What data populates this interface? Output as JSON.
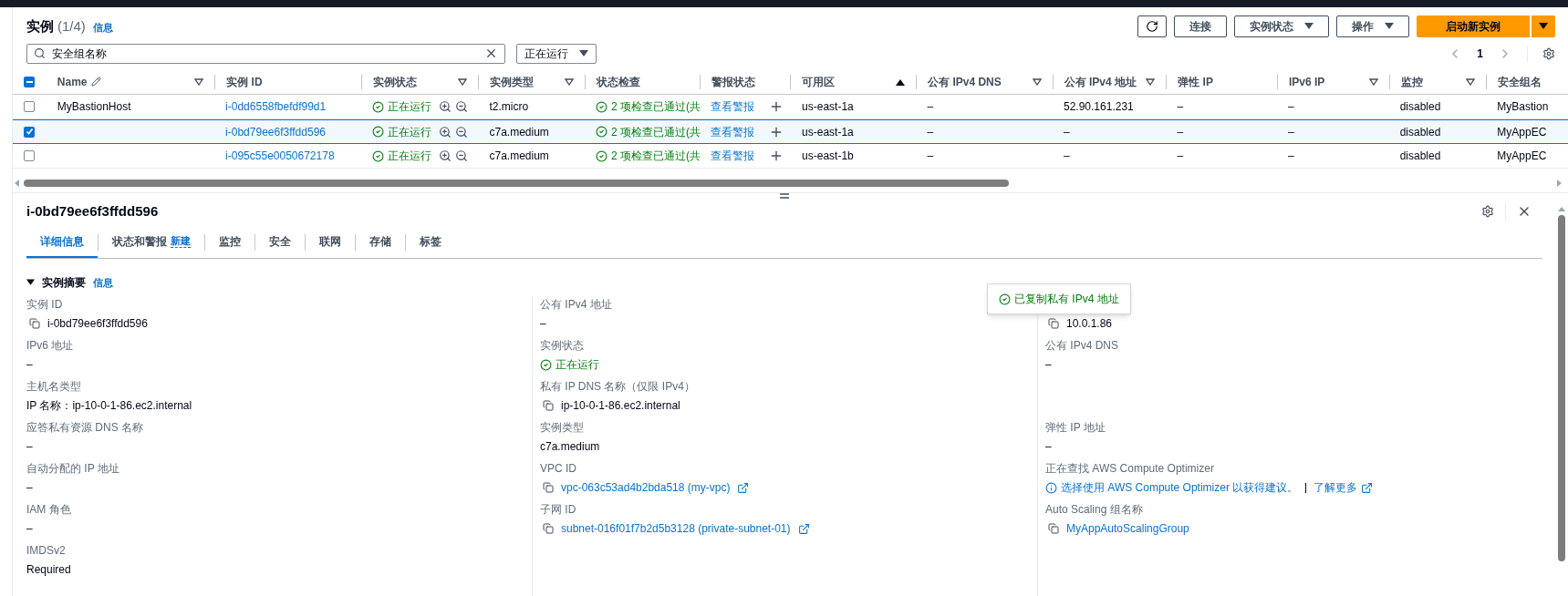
{
  "header": {
    "title": "实例",
    "count": "(1/4)",
    "info_link": "信息"
  },
  "toolbar": {
    "buttons": [
      {
        "kind": "refresh"
      },
      {
        "kind": "plain",
        "label": "连接"
      },
      {
        "kind": "dropdown",
        "label": "实例状态"
      },
      {
        "kind": "dropdown",
        "label": "操作"
      },
      {
        "kind": "primary",
        "label": "启动新实例"
      }
    ]
  },
  "search": {
    "value": "安全组名称"
  },
  "state_filter": {
    "value": "正在运行"
  },
  "pagination": {
    "page": "1"
  },
  "table": {
    "all_selected_partial": true,
    "columns": [
      {
        "label": "Name",
        "kind": "text",
        "filterable": true,
        "sorted_ascending": false,
        "editable": true
      },
      {
        "label": "实例 ID",
        "kind": "link",
        "filterable": false,
        "sorted_ascending": false,
        "editable": false
      },
      {
        "label": "实例状态",
        "kind": "status",
        "filterable": true,
        "sorted_ascending": false,
        "editable": false
      },
      {
        "label": "实例类型",
        "kind": "text",
        "filterable": true,
        "sorted_ascending": false,
        "editable": false
      },
      {
        "label": "状态检查",
        "kind": "check",
        "filterable": false,
        "sorted_ascending": false,
        "editable": false
      },
      {
        "label": "警报状态",
        "kind": "alarm",
        "filterable": false,
        "sorted_ascending": false,
        "editable": false
      },
      {
        "label": "可用区",
        "kind": "text",
        "filterable": false,
        "sorted_ascending": true,
        "editable": false
      },
      {
        "label": "公有 IPv4 DNS",
        "kind": "text",
        "filterable": true,
        "sorted_ascending": false,
        "editable": false
      },
      {
        "label": "公有 IPv4 地址",
        "kind": "text",
        "filterable": true,
        "sorted_ascending": false,
        "editable": false
      },
      {
        "label": "弹性 IP",
        "kind": "text",
        "filterable": false,
        "sorted_ascending": false,
        "editable": false
      },
      {
        "label": "IPv6 IP",
        "kind": "text",
        "filterable": true,
        "sorted_ascending": false,
        "editable": false
      },
      {
        "label": "监控",
        "kind": "text",
        "filterable": true,
        "sorted_ascending": false,
        "editable": false
      },
      {
        "label": "安全组名",
        "kind": "text",
        "filterable": false,
        "sorted_ascending": false,
        "editable": false
      }
    ],
    "rows": [
      {
        "selected": false,
        "cells": [
          "MyBastionHost",
          "i-0dd6558fbefdf99d1",
          "正在运行",
          "t2.micro",
          "2 项检查已通过(共",
          "查看警报",
          "us-east-1a",
          "–",
          "52.90.161.231",
          "–",
          "–",
          "disabled",
          "MyBastion"
        ]
      },
      {
        "selected": true,
        "cells": [
          "",
          "i-0bd79ee6f3ffdd596",
          "正在运行",
          "c7a.medium",
          "2 项检查已通过(共",
          "查看警报",
          "us-east-1a",
          "–",
          "–",
          "–",
          "–",
          "disabled",
          "MyAppEC"
        ]
      },
      {
        "selected": false,
        "cells": [
          "",
          "i-095c55e0050672178",
          "正在运行",
          "c7a.medium",
          "2 项检查已通过(共",
          "查看警报",
          "us-east-1b",
          "–",
          "–",
          "–",
          "–",
          "disabled",
          "MyAppEC"
        ]
      }
    ]
  },
  "details": {
    "title": "i-0bd79ee6f3ffdd596",
    "tabs": [
      {
        "label": "详细信息",
        "selected": true
      },
      {
        "label": "状态和警报",
        "badge": "新建",
        "selected": false
      },
      {
        "label": "监控",
        "selected": false
      },
      {
        "label": "安全",
        "selected": false
      },
      {
        "label": "联网",
        "selected": false
      },
      {
        "label": "存储",
        "selected": false
      },
      {
        "label": "标签",
        "selected": false
      }
    ],
    "section": {
      "title": "实例摘要",
      "info_link": "信息",
      "expanded": true
    },
    "columns": [
      [
        {
          "label": "实例 ID",
          "value": "i-0bd79ee6f3ffdd596",
          "kind": "copy"
        },
        {
          "label": "IPv6 地址",
          "value": "–",
          "kind": "text"
        },
        {
          "label": "主机名类型",
          "value": "IP 名称：ip-10-0-1-86.ec2.internal",
          "kind": "text"
        },
        {
          "label": "应答私有资源 DNS 名称",
          "value": "–",
          "kind": "text"
        },
        {
          "label": "自动分配的 IP 地址",
          "value": "–",
          "kind": "text"
        },
        {
          "label": "IAM 角色",
          "value": "–",
          "kind": "text"
        },
        {
          "label": "IMDSv2",
          "value": "Required",
          "kind": "text"
        }
      ],
      [
        {
          "label": "公有 IPv4 地址",
          "value": "–",
          "kind": "text"
        },
        {
          "label": "实例状态",
          "value": "正在运行",
          "kind": "status"
        },
        {
          "label": "私有 IP DNS 名称（仅限 IPv4）",
          "value": "ip-10-0-1-86.ec2.internal",
          "kind": "copy"
        },
        {
          "label": "实例类型",
          "value": "c7a.medium",
          "kind": "text"
        },
        {
          "label": "VPC ID",
          "value": "vpc-063c53ad4b2bda518 (my-vpc)",
          "kind": "copy_link"
        },
        {
          "label": "子网 ID",
          "value": "subnet-016f01f7b2d5b3128 (private-subnet-01)",
          "kind": "copy_link"
        }
      ],
      [
        {
          "value": "10.0.1.86",
          "kind": "copy"
        },
        {
          "label": "公有 IPv4 DNS",
          "value": "–",
          "kind": "text"
        },
        {
          "kind": "gap"
        },
        {
          "label": "弹性 IP 地址",
          "value": "–",
          "kind": "text"
        },
        {
          "label": "正在查找 AWS Compute Optimizer",
          "value": "选择使用 AWS Compute Optimizer 以获得建议。",
          "link": "了解更多",
          "kind": "optimizer"
        },
        {
          "label": "Auto Scaling 组名称",
          "value": "MyAppAutoScalingGroup",
          "kind": "copy_link_plain"
        }
      ]
    ],
    "toast": {
      "message": "已复制私有 IPv4 地址"
    }
  }
}
